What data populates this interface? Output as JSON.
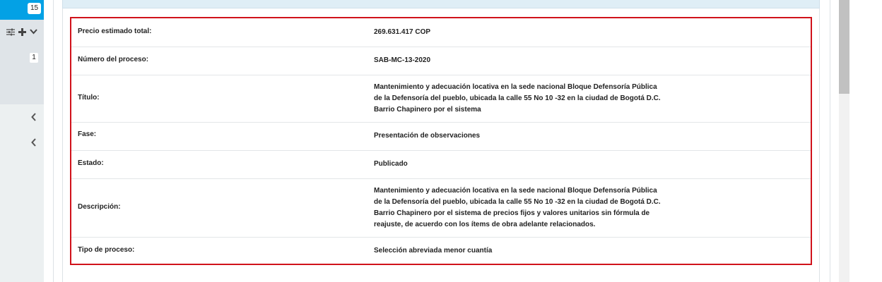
{
  "sidebar": {
    "badge_top": "15",
    "badge_second": "1",
    "tools": [
      {
        "icon": "sliders-icon",
        "glyph": "⚟"
      },
      {
        "icon": "plus-icon",
        "glyph": "✚"
      },
      {
        "icon": "chevron-down-icon",
        "glyph": "⌄"
      }
    ],
    "chevrons": [
      "‹",
      "‹"
    ]
  },
  "details": {
    "rows": [
      {
        "label": "Precio estimado total:",
        "value": [
          "269.631.417 COP"
        ]
      },
      {
        "label": "Número del proceso:",
        "value": [
          "SAB-MC-13-2020"
        ]
      },
      {
        "label": "Título:",
        "value": [
          "Mantenimiento y adecuación locativa en la sede nacional Bloque Defensoría Pública",
          "de la Defensoría del pueblo, ubicada la calle 55 No 10 -32 en la ciudad de Bogotá D.C.",
          "Barrio Chapinero por el sistema"
        ]
      },
      {
        "label": "Fase:",
        "value": [
          "Presentación de observaciones"
        ]
      },
      {
        "label": "Estado:",
        "value": [
          "Publicado"
        ]
      },
      {
        "label": "Descripción:",
        "value": [
          "Mantenimiento y adecuación locativa en la sede nacional Bloque Defensoría Pública",
          "de la Defensoría del pueblo, ubicada la calle 55 No 10 -32 en la ciudad de Bogotá D.C.",
          "Barrio Chapinero por el sistema de precios fijos y valores unitarios sin fórmula de",
          "reajuste, de acuerdo con los ítems de obra adelante relacionados."
        ]
      },
      {
        "label": "Tipo de proceso:",
        "value": [
          "Selección abreviada menor cuantía"
        ]
      }
    ]
  },
  "colors": {
    "accent_blue": "#03a1e5",
    "highlight_red": "#d0121b"
  }
}
